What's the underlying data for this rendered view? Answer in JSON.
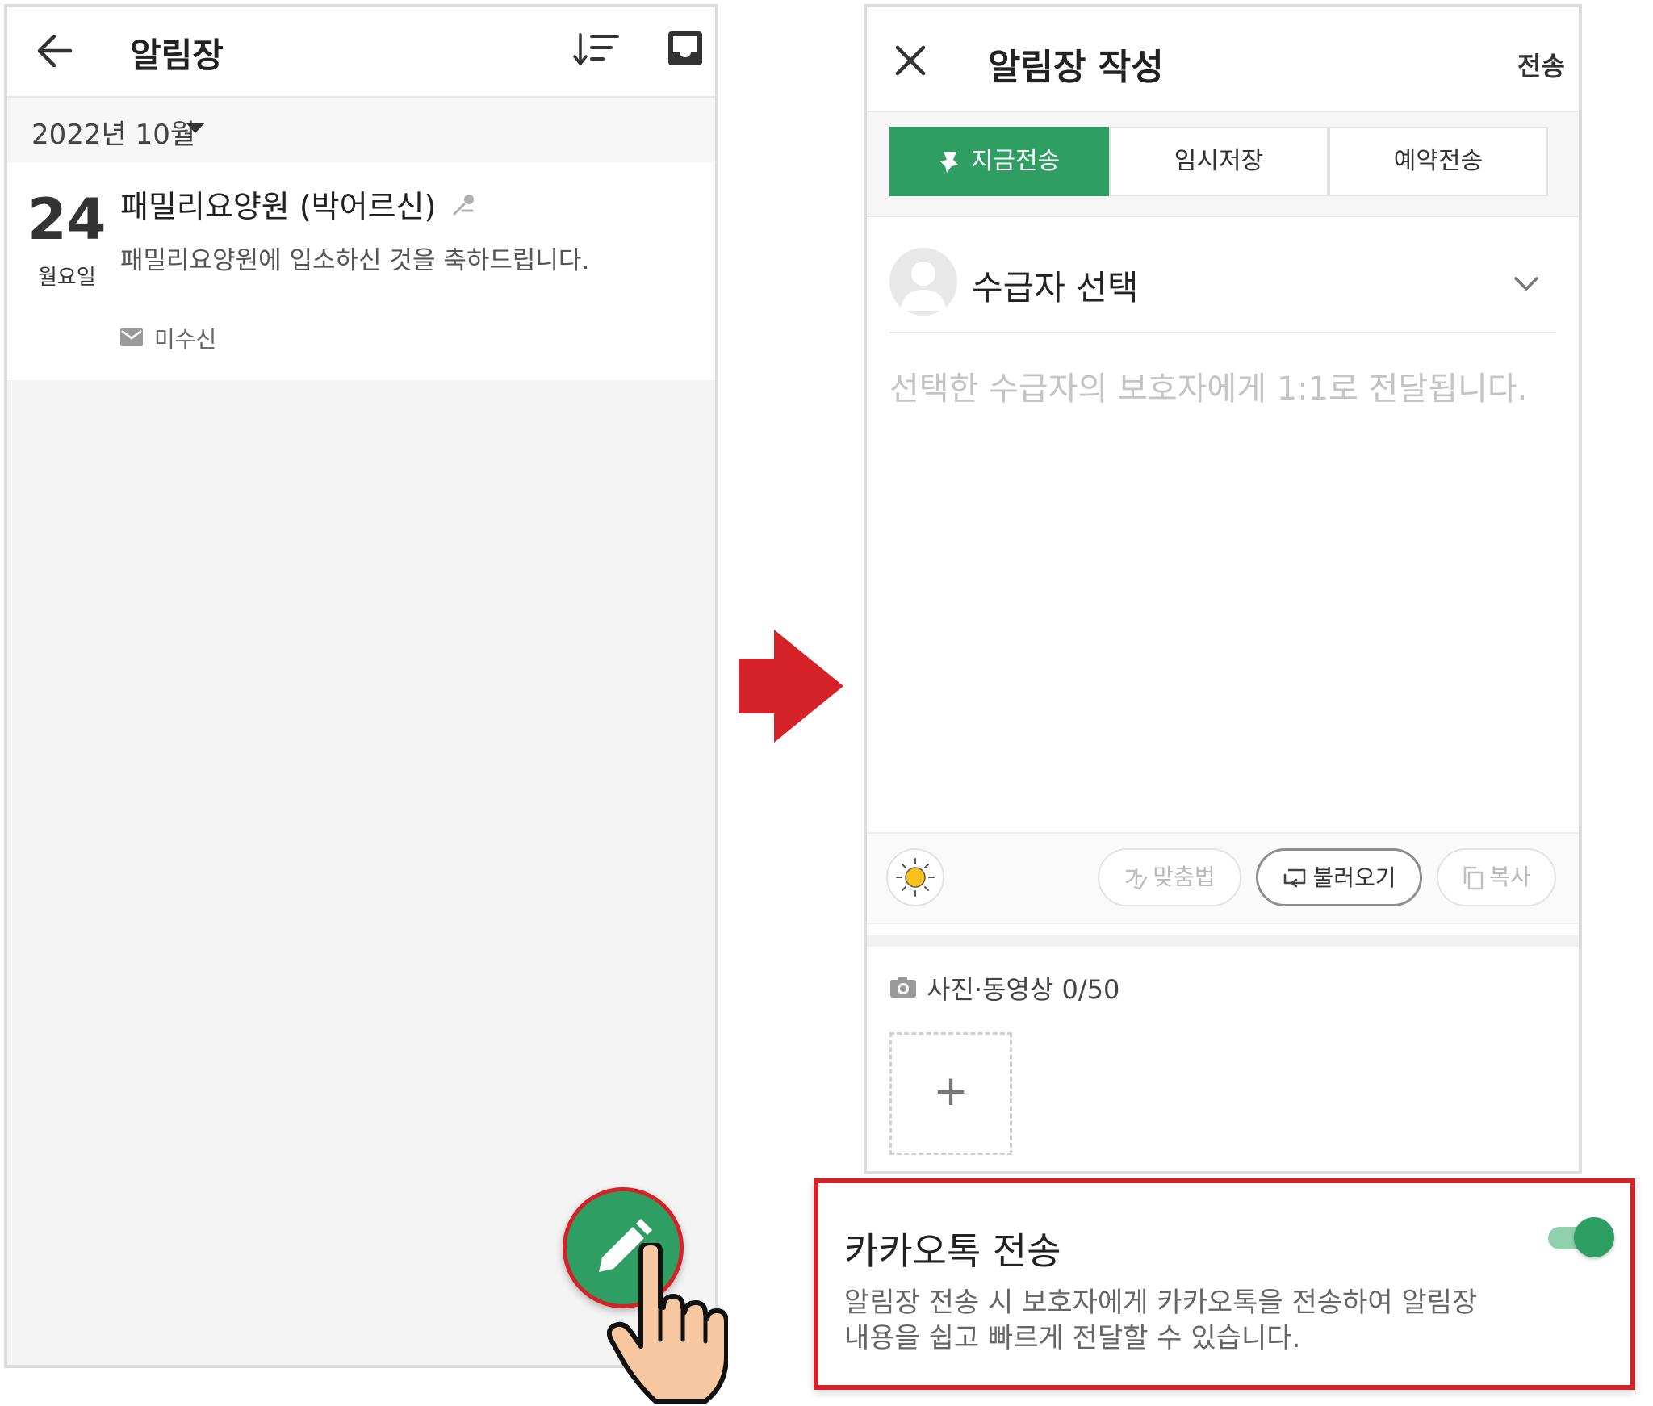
{
  "left": {
    "title": "알림장",
    "month": "2022년 10월",
    "note": {
      "day": "24",
      "weekday": "월요일",
      "title": "패밀리요양원 (박어르신)",
      "body": "패밀리요양원에 입소하신 것을 축하드립니다.",
      "status": "미수신"
    }
  },
  "right": {
    "title": "알림장 작성",
    "send_label": "전송",
    "tabs": [
      {
        "label": "지금전송",
        "selected": true
      },
      {
        "label": "임시저장",
        "selected": false
      },
      {
        "label": "예약전송",
        "selected": false
      }
    ],
    "recipient_label": "수급자 선택",
    "message_placeholder": "선택한 수급자의 보호자에게 1:1로 전달됩니다.",
    "toolbar": {
      "spell_label": "맞춤법",
      "load_label": "불러오기",
      "copy_label": "복사"
    },
    "media_label": "사진·동영상 0/50",
    "media_add_label": "+"
  },
  "kakao": {
    "title": "카카오톡 전송",
    "description_line1": "알림장 전송 시 보호자에게 카카오톡을 전송하여 알림장",
    "description_line2": "내용을 쉽고 빠르게 전달할 수 있습니다.",
    "toggle_on": true
  },
  "colors": {
    "accent_green": "#2e9e63",
    "highlight_red": "#d42228"
  },
  "icons": [
    "back-arrow-icon",
    "sort-icon",
    "inbox-icon",
    "pin-icon",
    "mail-icon",
    "pencil-icon",
    "hand-pointer-icon",
    "close-icon",
    "pin-icon",
    "avatar-icon",
    "chevron-down-icon",
    "sun-icon",
    "spellcheck-icon",
    "load-icon",
    "copy-icon",
    "camera-icon",
    "red-arrow-icon"
  ]
}
